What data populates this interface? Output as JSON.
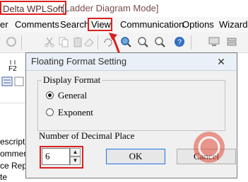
{
  "titlebar": {
    "app_name": "Delta WPLSoft",
    "mode": "- [Ladder Diagram Mode]"
  },
  "menu": {
    "items": [
      {
        "label": "er",
        "underline": ""
      },
      {
        "label": "Comments",
        "underline": "C"
      },
      {
        "label": "Search",
        "underline": ""
      },
      {
        "label": "View",
        "underline": "V"
      },
      {
        "label": "Communication",
        "underline": "C"
      },
      {
        "label": "Options",
        "underline": "O"
      },
      {
        "label": "Wizard",
        "underline": "W"
      }
    ]
  },
  "toolbar": {
    "icons": [
      "refresh-icon",
      "cut-icon",
      "copy-icon",
      "paste-icon",
      "eraser-icon",
      "undo-icon",
      "zoom-in-icon",
      "zoom-out-icon",
      "magnifier-icon",
      "help-icon",
      "monitor-icon",
      "network-icon"
    ]
  },
  "left_panel": {
    "f2_label": "F2",
    "lines": [
      "escriptio",
      "omment",
      "ce Rep",
      "te"
    ]
  },
  "dialog": {
    "title": "Floating Format Setting",
    "close_glyph": "✕",
    "display_format_label": "Display Format",
    "options": [
      {
        "label": "General",
        "checked": true
      },
      {
        "label": "Exponent",
        "checked": false
      }
    ],
    "decimal_label": "Number of Decimal Place",
    "decimal_value": "6",
    "ok_label": "OK",
    "cancel_label": "Cancel"
  },
  "colors": {
    "highlight": "#d9201f",
    "dialog_bg": "#f0f0f0",
    "title_bg": "#e9f0f7"
  }
}
